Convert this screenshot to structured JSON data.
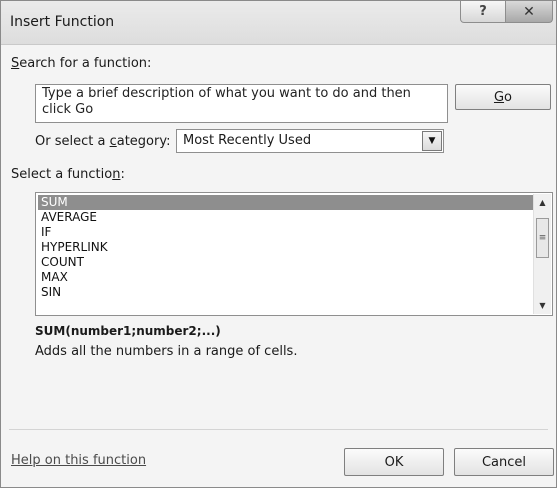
{
  "dialog": {
    "title": "Insert Function",
    "help_glyph": "?",
    "close_glyph": "✕"
  },
  "search": {
    "label_pre": "",
    "label_key": "S",
    "label_post": "earch for a function:",
    "text": "Type a brief description of what you want to do and then click Go",
    "go_pre": "",
    "go_key": "G",
    "go_post": "o"
  },
  "category": {
    "label_pre": "Or select a ",
    "label_key": "c",
    "label_post": "ategory:",
    "selected": "Most Recently Used"
  },
  "functions": {
    "label_pre": "Select a functio",
    "label_key": "n",
    "label_post": ":",
    "items": [
      "SUM",
      "AVERAGE",
      "IF",
      "HYPERLINK",
      "COUNT",
      "MAX",
      "SIN"
    ],
    "selected_index": 0
  },
  "details": {
    "signature": "SUM(number1;number2;...)",
    "description": "Adds all the numbers in a range of cells."
  },
  "footer": {
    "help_link": "Help on this function",
    "ok_label": "OK",
    "cancel_label": "Cancel"
  },
  "icons": {
    "combo_arrow": "chevron-down-icon",
    "scroll_up": "scroll-up-icon",
    "scroll_down": "scroll-down-icon",
    "scroll_grip": "grip-icon"
  }
}
